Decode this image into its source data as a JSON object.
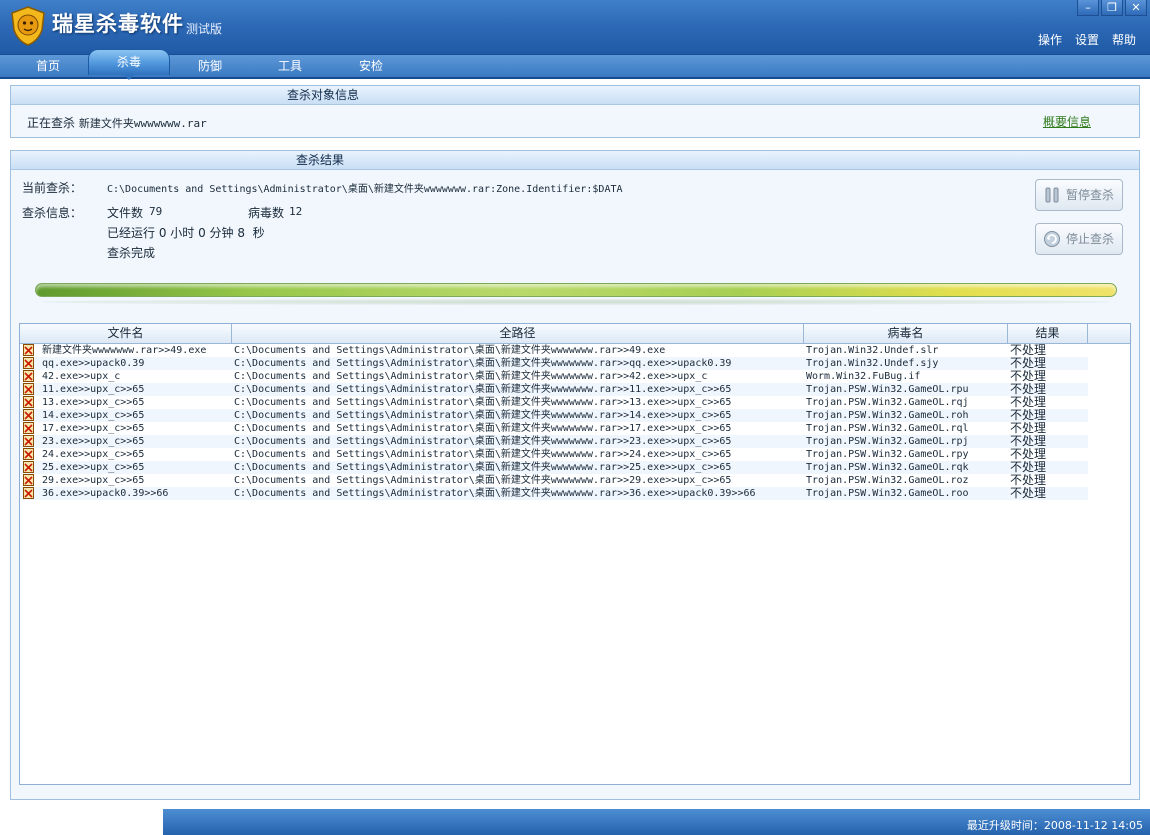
{
  "app": {
    "title": "瑞星杀毒软件",
    "edition": "测试版",
    "logo_icon": "lion-shield-logo",
    "window_controls": [
      "minimize",
      "restore",
      "close"
    ]
  },
  "top_menu": [
    "操作",
    "设置",
    "帮助"
  ],
  "tabs": [
    {
      "label": "首页",
      "active": false
    },
    {
      "label": "杀毒",
      "active": true
    },
    {
      "label": "防御",
      "active": false
    },
    {
      "label": "工具",
      "active": false
    },
    {
      "label": "安检",
      "active": false
    }
  ],
  "target_panel": {
    "title": "查杀对象信息",
    "scanning_label": "正在查杀",
    "scanning_value": "新建文件夹wwwwwww.rar",
    "summary_link": "概要信息"
  },
  "result_panel": {
    "title": "查杀结果",
    "current_label": "当前查杀：",
    "current_path": "C:\\Documents and Settings\\Administrator\\桌面\\新建文件夹wwwwwww.rar:Zone.Identifier:$DATA",
    "info_label": "查杀信息：",
    "files_label": "文件数",
    "files_count": "79",
    "virus_label": "病毒数",
    "virus_count": "12",
    "elapsed": "已经运行 0 小时 0 分钟 8  秒",
    "status": "查杀完成",
    "pause_button": "暂停查杀",
    "stop_button": "停止查杀",
    "progress_fraction": 1.0
  },
  "table": {
    "columns": [
      "文件名",
      "全路径",
      "病毒名",
      "结果"
    ],
    "rows": [
      {
        "file": "新建文件夹wwwwwww.rar>>49.exe",
        "path": "C:\\Documents and Settings\\Administrator\\桌面\\新建文件夹wwwwwww.rar>>49.exe",
        "virus": "Trojan.Win32.Undef.slr",
        "result": "不处理"
      },
      {
        "file": "qq.exe>>upack0.39",
        "path": "C:\\Documents and Settings\\Administrator\\桌面\\新建文件夹wwwwwww.rar>>qq.exe>>upack0.39",
        "virus": "Trojan.Win32.Undef.sjy",
        "result": "不处理"
      },
      {
        "file": "42.exe>>upx_c",
        "path": "C:\\Documents and Settings\\Administrator\\桌面\\新建文件夹wwwwwww.rar>>42.exe>>upx_c",
        "virus": "Worm.Win32.FuBug.if",
        "result": "不处理"
      },
      {
        "file": "11.exe>>upx_c>>65",
        "path": "C:\\Documents and Settings\\Administrator\\桌面\\新建文件夹wwwwwww.rar>>11.exe>>upx_c>>65",
        "virus": "Trojan.PSW.Win32.GameOL.rpu",
        "result": "不处理"
      },
      {
        "file": "13.exe>>upx_c>>65",
        "path": "C:\\Documents and Settings\\Administrator\\桌面\\新建文件夹wwwwwww.rar>>13.exe>>upx_c>>65",
        "virus": "Trojan.PSW.Win32.GameOL.rqj",
        "result": "不处理"
      },
      {
        "file": "14.exe>>upx_c>>65",
        "path": "C:\\Documents and Settings\\Administrator\\桌面\\新建文件夹wwwwwww.rar>>14.exe>>upx_c>>65",
        "virus": "Trojan.PSW.Win32.GameOL.roh",
        "result": "不处理"
      },
      {
        "file": "17.exe>>upx_c>>65",
        "path": "C:\\Documents and Settings\\Administrator\\桌面\\新建文件夹wwwwwww.rar>>17.exe>>upx_c>>65",
        "virus": "Trojan.PSW.Win32.GameOL.rql",
        "result": "不处理"
      },
      {
        "file": "23.exe>>upx_c>>65",
        "path": "C:\\Documents and Settings\\Administrator\\桌面\\新建文件夹wwwwwww.rar>>23.exe>>upx_c>>65",
        "virus": "Trojan.PSW.Win32.GameOL.rpj",
        "result": "不处理"
      },
      {
        "file": "24.exe>>upx_c>>65",
        "path": "C:\\Documents and Settings\\Administrator\\桌面\\新建文件夹wwwwwww.rar>>24.exe>>upx_c>>65",
        "virus": "Trojan.PSW.Win32.GameOL.rpy",
        "result": "不处理"
      },
      {
        "file": "25.exe>>upx_c>>65",
        "path": "C:\\Documents and Settings\\Administrator\\桌面\\新建文件夹wwwwwww.rar>>25.exe>>upx_c>>65",
        "virus": "Trojan.PSW.Win32.GameOL.rqk",
        "result": "不处理"
      },
      {
        "file": "29.exe>>upx_c>>65",
        "path": "C:\\Documents and Settings\\Administrator\\桌面\\新建文件夹wwwwwww.rar>>29.exe>>upx_c>>65",
        "virus": "Trojan.PSW.Win32.GameOL.roz",
        "result": "不处理"
      },
      {
        "file": "36.exe>>upack0.39>>66",
        "path": "C:\\Documents and Settings\\Administrator\\桌面\\新建文件夹wwwwwww.rar>>36.exe>>upack0.39>>66",
        "virus": "Trojan.PSW.Win32.GameOL.roo",
        "result": "不处理"
      }
    ]
  },
  "status_bar": {
    "update_text": "最近升级时间：2008-11-12 14:05"
  }
}
